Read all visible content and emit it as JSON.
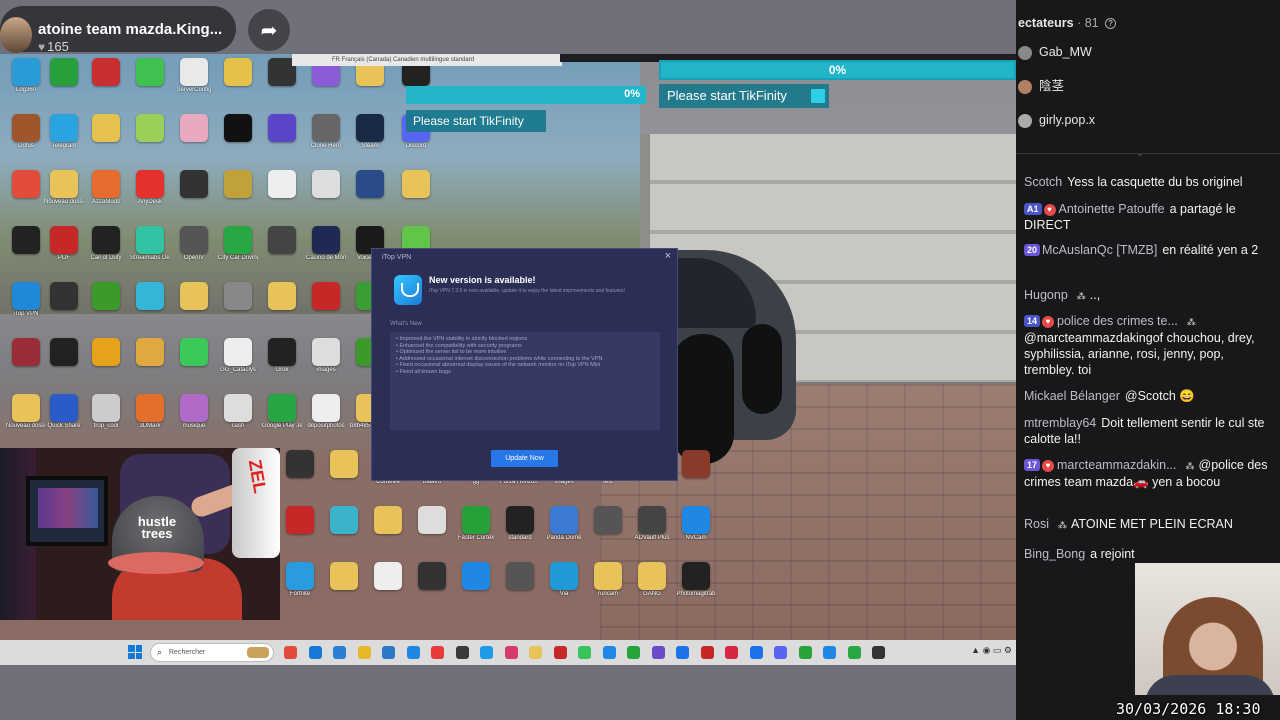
{
  "stream": {
    "title": "atoine team mazda.King...",
    "likes": "165"
  },
  "overlay": {
    "top_strip_text": "FR Français (Canada)          Canadien multilingue standard",
    "progress_large_pct": "0%",
    "progress_small_pct": "0%",
    "tikfinity_msg": "Please start TikFinity"
  },
  "desktop_icons": [
    {
      "label": "Log360",
      "color": "#2a9bd6"
    },
    {
      "label": "",
      "color": "#27a03b"
    },
    {
      "label": "",
      "color": "#c7302f"
    },
    {
      "label": "",
      "color": "#3ec14f"
    },
    {
      "label": "ServerConfig",
      "color": "#e9e9e9"
    },
    {
      "label": "",
      "color": "#e6c14a"
    },
    {
      "label": "",
      "color": "#333"
    },
    {
      "label": "",
      "color": "#8a5cd6"
    },
    {
      "label": "",
      "color": "#e8c35a"
    },
    {
      "label": "",
      "color": "#222"
    },
    {
      "label": "Dofus",
      "color": "#a0562c"
    },
    {
      "label": "Telegram",
      "color": "#2aa3e0"
    },
    {
      "label": "",
      "color": "#e5c250"
    },
    {
      "label": "",
      "color": "#9bcf5a"
    },
    {
      "label": "",
      "color": "#e7a9c0"
    },
    {
      "label": "",
      "color": "#111"
    },
    {
      "label": "",
      "color": "#5b45c9"
    },
    {
      "label": "Clone Hero",
      "color": "#666"
    },
    {
      "label": "Steam",
      "color": "#1b2a44"
    },
    {
      "label": "Discord",
      "color": "#5865f2"
    },
    {
      "label": "",
      "color": "#e14c3c"
    },
    {
      "label": "Nouveau dossier",
      "color": "#e8c35a"
    },
    {
      "label": "AzzaMods",
      "color": "#e56b2e"
    },
    {
      "label": "AnyDesk",
      "color": "#e5312e"
    },
    {
      "label": "",
      "color": "#333"
    },
    {
      "label": "",
      "color": "#c1a23a"
    },
    {
      "label": "",
      "color": "#eee"
    },
    {
      "label": "",
      "color": "#ddd"
    },
    {
      "label": "",
      "color": "#2a4b8a"
    },
    {
      "label": "",
      "color": "#e8c35a"
    },
    {
      "label": "",
      "color": "#222"
    },
    {
      "label": "PDF",
      "color": "#c62828"
    },
    {
      "label": "Call of Duty",
      "color": "#222"
    },
    {
      "label": "Streamlabs Desktop",
      "color": "#31c3a2"
    },
    {
      "label": "OpenIV",
      "color": "#555"
    },
    {
      "label": "City Car Driving",
      "color": "#28a745"
    },
    {
      "label": "",
      "color": "#444"
    },
    {
      "label": "Casino de Montréal",
      "color": "#1e2a55"
    },
    {
      "label": "Voicemod",
      "color": "#1a1a1a"
    },
    {
      "label": "BlueStacks 5",
      "color": "#5fc64a"
    },
    {
      "label": "iTop VPN",
      "color": "#2088d8"
    },
    {
      "label": "",
      "color": "#333"
    },
    {
      "label": "",
      "color": "#3b9a2a"
    },
    {
      "label": "",
      "color": "#35b6d9"
    },
    {
      "label": "",
      "color": "#e8c35a"
    },
    {
      "label": "",
      "color": "#888"
    },
    {
      "label": "",
      "color": "#e8c35a"
    },
    {
      "label": "",
      "color": "#c62828"
    },
    {
      "label": "",
      "color": "#3a9e34"
    },
    {
      "label": "",
      "color": "#333"
    },
    {
      "label": "",
      "color": "#9a2e38"
    },
    {
      "label": "",
      "color": "#222"
    },
    {
      "label": "",
      "color": "#e6a21a"
    },
    {
      "label": "",
      "color": "#e0a840"
    },
    {
      "label": "",
      "color": "#3ac95a"
    },
    {
      "label": "GG_Cataclys",
      "color": "#eee"
    },
    {
      "label": "Grok",
      "color": "#222"
    },
    {
      "label": "images",
      "color": "#ddd"
    },
    {
      "label": "",
      "color": "#3b9a2a"
    },
    {
      "label": "",
      "color": "#b85a3a"
    },
    {
      "label": "Nouveau dossier (3)",
      "color": "#e8c35a"
    },
    {
      "label": "Quick Share",
      "color": "#2a5bc8"
    },
    {
      "label": "trop_cool",
      "color": "#ccc"
    },
    {
      "label": "3DMark",
      "color": "#e2702a"
    },
    {
      "label": "musique",
      "color": "#b06ac8"
    },
    {
      "label": "cash",
      "color": "#ddd"
    },
    {
      "label": "Google Play Jeux bêta",
      "color": "#27a743"
    },
    {
      "label": "depositphotos",
      "color": "#eee"
    },
    {
      "label": "b8b485-Speed Express",
      "color": "#e8c35a"
    },
    {
      "label": "3DMark Demo",
      "color": "#e2702a"
    },
    {
      "label": "",
      "color": "#333"
    },
    {
      "label": "",
      "color": "#e8c35a"
    },
    {
      "label": "Corbeille",
      "color": "#cfe3f2"
    },
    {
      "label": "Balatro",
      "color": "#c93a3a"
    },
    {
      "label": "gg",
      "color": "#e8c35a"
    },
    {
      "label": "Forza Horizon 5",
      "color": "#eee"
    },
    {
      "label": "images",
      "color": "#c93a3a"
    },
    {
      "label": "test",
      "color": "#e8c35a"
    },
    {
      "label": "",
      "color": "#7a3fb0"
    },
    {
      "label": "",
      "color": "#8a3a2a"
    },
    {
      "label": "",
      "color": "#c62828"
    },
    {
      "label": "",
      "color": "#3bb3c9"
    },
    {
      "label": "",
      "color": "#e8c35a"
    },
    {
      "label": "",
      "color": "#ddd"
    },
    {
      "label": "Faster Cortex",
      "color": "#25a13a"
    },
    {
      "label": "standard",
      "color": "#222"
    },
    {
      "label": "Panda Dome",
      "color": "#3b7bd6"
    },
    {
      "label": "",
      "color": "#555"
    },
    {
      "label": "ADVault Plus",
      "color": "#444"
    },
    {
      "label": "NVCam",
      "color": "#1f88e5"
    },
    {
      "label": "Fortnite",
      "color": "#2a9be0"
    },
    {
      "label": "",
      "color": "#e8c35a"
    },
    {
      "label": "",
      "color": "#eee"
    },
    {
      "label": "",
      "color": "#333"
    },
    {
      "label": "",
      "color": "#1f88e5"
    },
    {
      "label": "",
      "color": "#555"
    },
    {
      "label": "Via",
      "color": "#1f9ad6"
    },
    {
      "label": "runcam",
      "color": "#e8c35a"
    },
    {
      "label": "GANG",
      "color": "#e8c35a"
    },
    {
      "label": "Photomagitrab",
      "color": "#222"
    }
  ],
  "vpn": {
    "window_title": "iTop VPN",
    "heading": "New version is available!",
    "subtitle": "iTop VPN 7.3.0 is now available, update it to enjoy the latest improvements and features!",
    "whats_new": "What's New",
    "notes": [
      "• Improved the VPN stability in strictly blocked regions",
      "• Enhanced the compatibility with security programs",
      "• Optimized the server list to be more intuitive",
      "• Addressed occasional internet disconnection problems while connecting to the VPN",
      "• Fixed occasional abnormal display issues of the network monitor on iTop VPN Mini",
      "• Fixed all known bugs"
    ],
    "update_label": "Update Now"
  },
  "webcam": {
    "cap_text": "hustle trees",
    "cup_text": "ZEL"
  },
  "taskbar": {
    "search_placeholder": "Rechercher",
    "apps": [
      "#e24a3a",
      "#1479d9",
      "#2a7fd4",
      "#e8b72a",
      "#2b78c6",
      "#1f88e5",
      "#e83a3a",
      "#3a3a3a",
      "#1e9be8",
      "#d63a6a",
      "#e8c35a",
      "#c62828",
      "#37c45a",
      "#1f88e5",
      "#26a43a",
      "#6a4ac8",
      "#1a73e8",
      "#c62828",
      "#d62846",
      "#1a73e8",
      "#5865f2",
      "#26a43a",
      "#1f88e5",
      "#27a743",
      "#333"
    ]
  },
  "chat": {
    "viewers_title": "ectateurs",
    "viewers_count": "· 81",
    "viewers": [
      {
        "name": "Gab_MW",
        "color": "#888"
      },
      {
        "name": "陰茎",
        "color": "#b08060"
      },
      {
        "name": "girly.pop.x",
        "color": "#aaa"
      }
    ],
    "messages": [
      {
        "user": "Scotch",
        "text": "Yess la casquette du bs originel"
      },
      {
        "badge": "A1",
        "user": "Antoinette Patouffe",
        "text": "a partagé le DIRECT"
      },
      {
        "badge": "20",
        "user": "McAuslanQc [TMZB]",
        "text": "en réalité yen a 2"
      },
      {
        "user": "Hugonp",
        "text": "..,"
      },
      {
        "badge": "14",
        "user": "police des crimes te...",
        "text": "@marcteammazdakingof chouchou, drey, syphilissia, arianne, rosi, jenny, pop, trembley. toi"
      },
      {
        "user": "Mickael Bélanger",
        "text": "@Scotch 😄"
      },
      {
        "user": "mtremblay64",
        "text": "Doit tellement sentir le cul ste calotte la!!"
      },
      {
        "badge": "17",
        "user": "marcteammazdakin...",
        "text": "@police des crimes team mazda🚗 yen a bocou"
      },
      {
        "user": "Rosi",
        "text": "ATOINE MET PLEIN ECRAN"
      },
      {
        "user": "Bing_Bong",
        "text": "a rejoint"
      }
    ],
    "timestamp": "30/03/2026 18:30"
  }
}
